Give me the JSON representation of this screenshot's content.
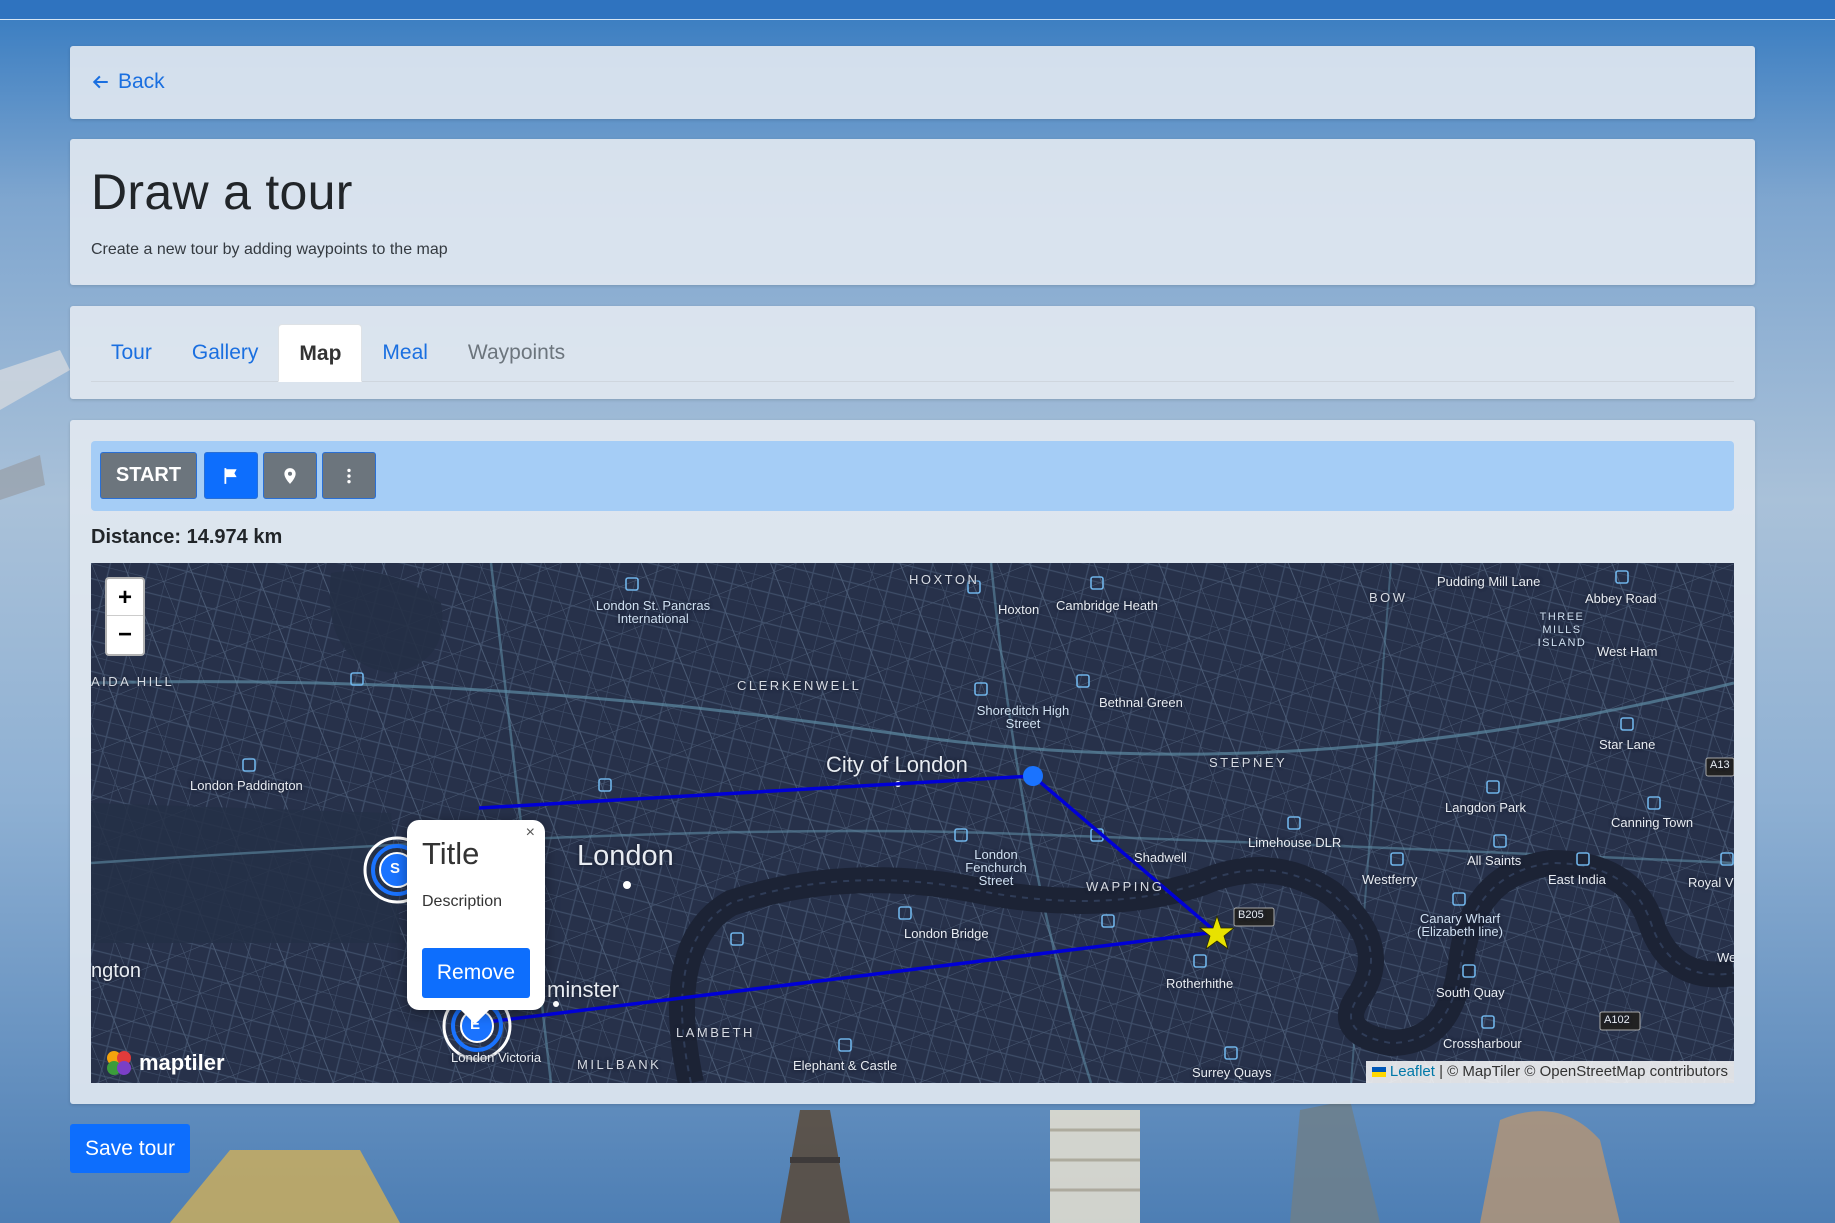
{
  "nav": {
    "back_label": "Back"
  },
  "header": {
    "title": "Draw a tour",
    "subtitle": "Create a new tour by adding waypoints to the map"
  },
  "tabs": [
    {
      "label": "Tour",
      "state": "link"
    },
    {
      "label": "Gallery",
      "state": "link"
    },
    {
      "label": "Map",
      "state": "active"
    },
    {
      "label": "Meal",
      "state": "link"
    },
    {
      "label": "Waypoints",
      "state": "disabled"
    }
  ],
  "toolbar": {
    "start_label": "START",
    "flag_icon": "flag-icon",
    "pin_icon": "map-pin-icon",
    "more_icon": "more-vertical-icon"
  },
  "distance": {
    "text": "Distance: 14.974 km"
  },
  "map": {
    "zoom_in": "+",
    "zoom_out": "−",
    "labels": {
      "hoxton": "HOXTON",
      "hoxton_st": "Hoxton",
      "cambridge_heath": "Cambridge Heath",
      "bow": "BOW",
      "pudding_mill": "Pudding Mill Lane",
      "abbey_road": "Abbey Road",
      "three_mills": "THREE MILLS ISLAND",
      "west_ham": "West Ham",
      "st_pancras": "London St. Pancras International",
      "aida_hill": "AIDA HILL",
      "clerkenwell": "CLERKENWELL",
      "shoreditch": "Shoreditch High Street",
      "bethnal_green": "Bethnal Green",
      "star_lane": "Star Lane",
      "a13": "A13",
      "paddington": "London Paddington",
      "city": "City of London",
      "stepney": "STEPNEY",
      "langdon_park": "Langdon Park",
      "canning_town": "Canning Town",
      "london": "London",
      "fenchurch": "London Fenchurch Street",
      "limehouse": "Limehouse DLR",
      "shadwell": "Shadwell",
      "all_saints": "All Saints",
      "east_india": "East India",
      "royal_vi": "Royal Vi",
      "westferry": "Westferry",
      "wapping": "WAPPING",
      "b205": "B205",
      "canary_wharf": "Canary Wharf (Elizabeth line)",
      "london_bridge": "London Bridge",
      "ngton": "ngton",
      "rotherhithe": "Rotherhithe",
      "we": "We",
      "minster": "minster",
      "south_quay": "South Quay",
      "lambeth": "LAMBETH",
      "a102": "A102",
      "crossharbour": "Crossharbour",
      "victoria": "London Victoria",
      "millbank": "MILLBANK",
      "elephant": "Elephant & Castle",
      "surrey_quays": "Surrey Quays"
    },
    "markers": {
      "start": "S",
      "end": "E"
    },
    "popup": {
      "close": "×",
      "title": "Title",
      "description": "Description",
      "remove_label": "Remove"
    },
    "logo": "maptiler",
    "attribution": {
      "leaflet": "Leaflet",
      "rest": "| © MapTiler © OpenStreetMap contributors"
    },
    "route_color": "#0000d6",
    "waypoint_color": "#1a73ff",
    "star_color": "#e8e200"
  },
  "footer": {
    "save_label": "Save tour"
  },
  "colors": {
    "primary": "#0d6efd",
    "secondary": "#6c757d",
    "toolbar_bg": "#a5cdf6"
  }
}
